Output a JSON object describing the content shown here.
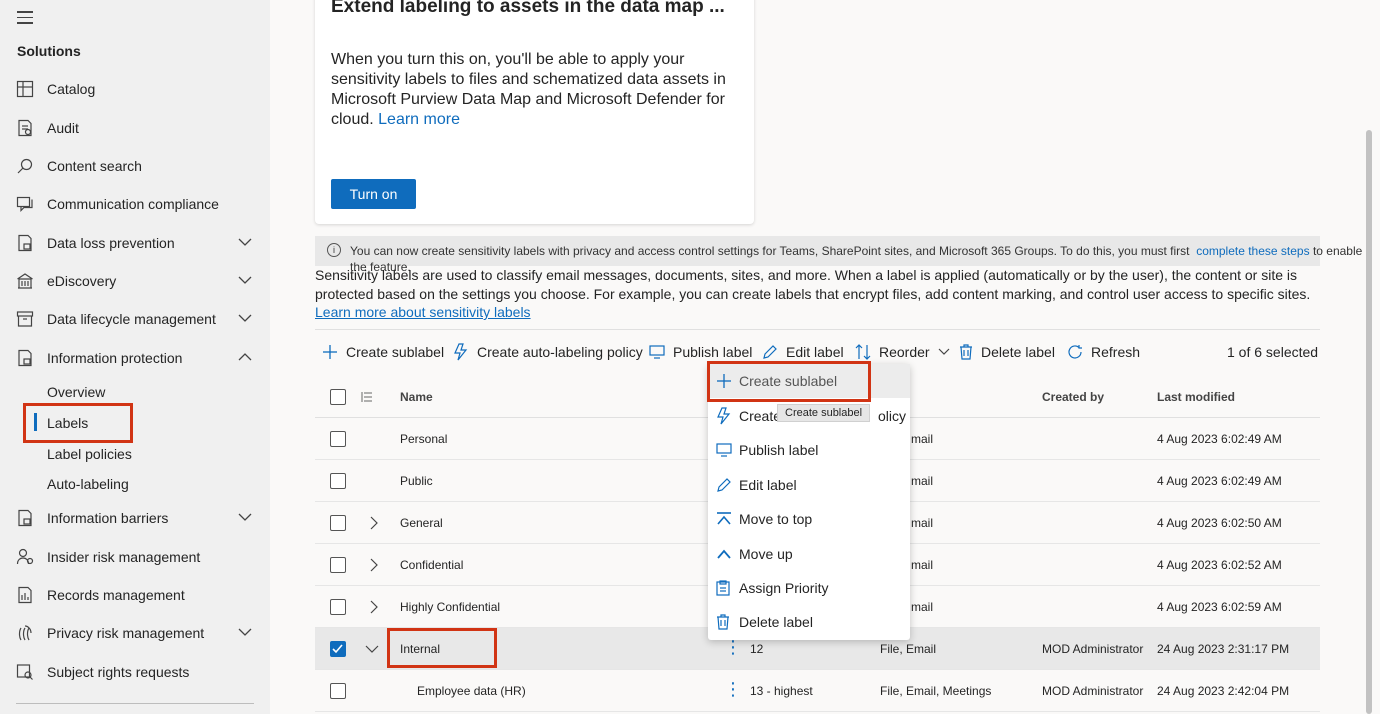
{
  "sidebar": {
    "title": "Solutions",
    "items": [
      {
        "label": "Catalog",
        "icon": "catalog-icon"
      },
      {
        "label": "Audit",
        "icon": "audit-icon"
      },
      {
        "label": "Content search",
        "icon": "search-icon"
      },
      {
        "label": "Communication compliance",
        "icon": "chat-icon"
      },
      {
        "label": "Data loss prevention",
        "icon": "dlp-icon"
      },
      {
        "label": "eDiscovery",
        "icon": "ediscovery-icon"
      },
      {
        "label": "Data lifecycle management",
        "icon": "lifecycle-icon"
      },
      {
        "label": "Information protection",
        "icon": "info-protection-icon"
      },
      {
        "label": "Information barriers",
        "icon": "barrier-icon"
      },
      {
        "label": "Insider risk management",
        "icon": "insider-risk-icon"
      },
      {
        "label": "Records management",
        "icon": "records-icon"
      },
      {
        "label": "Privacy risk management",
        "icon": "privacy-icon"
      },
      {
        "label": "Subject rights requests",
        "icon": "subject-rights-icon"
      }
    ],
    "sub_items": [
      "Overview",
      "Labels",
      "Label policies",
      "Auto-labeling"
    ]
  },
  "card": {
    "title": "Extend labeling to assets in the data map ...",
    "body": "When you turn this on, you'll be able to apply your sensitivity labels to files and schematized data assets in Microsoft Purview Data Map and Microsoft Defender for cloud.",
    "link": "Learn more",
    "button": "Turn on"
  },
  "info_banner": {
    "text": "You can now create sensitivity labels with privacy and access control settings for Teams, SharePoint sites, and Microsoft 365 Groups. To do this, you must first",
    "link": "complete these steps",
    "suffix": "to enable",
    "line2": "the feature."
  },
  "description": {
    "text": "Sensitivity labels are used to classify email messages, documents, sites, and more. When a label is applied (automatically or by the user), the content or site is protected based on the settings you choose. For example, you can create labels that encrypt files, add content marking, and control user access to specific sites.",
    "link": "Learn more about sensitivity labels"
  },
  "toolbar": {
    "create_sublabel": "Create sublabel",
    "create_auto": "Create auto-labeling policy",
    "publish": "Publish label",
    "edit": "Edit label",
    "reorder": "Reorder",
    "delete": "Delete label",
    "refresh": "Refresh",
    "selection": "1 of 6 selected"
  },
  "table": {
    "headers": {
      "name": "Name",
      "created_by": "Created by",
      "last_modified": "Last modified"
    },
    "rows": [
      {
        "name": "Personal",
        "priority": "",
        "scope": "mail",
        "created_by": "",
        "modified": "4 Aug 2023 6:02:49 AM"
      },
      {
        "name": "Public",
        "priority": "",
        "scope": "mail",
        "created_by": "",
        "modified": "4 Aug 2023 6:02:49 AM"
      },
      {
        "name": "General",
        "priority": "",
        "scope": "mail",
        "created_by": "",
        "modified": "4 Aug 2023 6:02:50 AM"
      },
      {
        "name": "Confidential",
        "priority": "",
        "scope": "mail",
        "created_by": "",
        "modified": "4 Aug 2023 6:02:52 AM"
      },
      {
        "name": "Highly Confidential",
        "priority": "",
        "scope": "mail",
        "created_by": "",
        "modified": "4 Aug 2023 6:02:59 AM"
      },
      {
        "name": "Internal",
        "priority": "12",
        "scope": "File, Email",
        "created_by": "MOD Administrator",
        "modified": "24 Aug 2023 2:31:17 PM"
      },
      {
        "name": "Employee data (HR)",
        "priority": "13 - highest",
        "scope": "File, Email, Meetings",
        "created_by": "MOD Administrator",
        "modified": "24 Aug 2023 2:42:04 PM"
      }
    ]
  },
  "context_menu": {
    "items": [
      "Create sublabel",
      "Create",
      "olicy",
      "Publish label",
      "Edit label",
      "Move to top",
      "Move up",
      "Assign Priority",
      "Delete label"
    ],
    "tooltip": "Create sublabel"
  },
  "colors": {
    "accent": "#0f6cbd",
    "highlight": "#d13414"
  }
}
